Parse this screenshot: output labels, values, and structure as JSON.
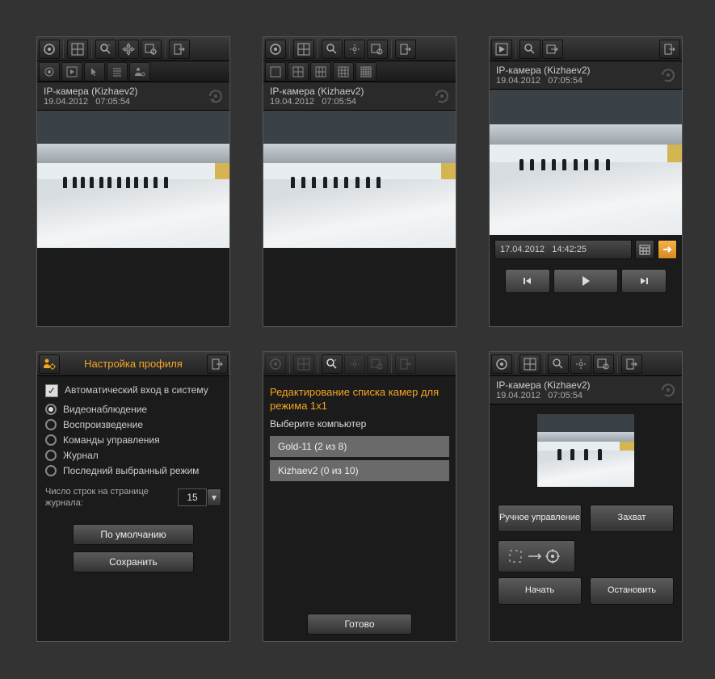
{
  "camera": {
    "name": "IP-камера (Kizhaev2)",
    "date": "19.04.2012",
    "time": "07:05:54"
  },
  "panel3": {
    "date": "17.04.2012",
    "time": "14:42:25"
  },
  "profile": {
    "title": "Настройка профиля",
    "autologin": "Автоматический вход в систему",
    "mode1": "Видеонаблюдение",
    "mode2": "Воспроизведение",
    "mode3": "Команды управления",
    "mode4": "Журнал",
    "mode5": "Последний выбранный режим",
    "lines_label": "Число строк на странице журнала:",
    "lines_value": "15",
    "btn_default": "По умолчанию",
    "btn_save": "Сохранить"
  },
  "editlist": {
    "title": "Редактирование списка камер для режима 1x1",
    "subtitle": "Выберите компьютер",
    "item1": "Gold-11 (2 из 8)",
    "item2": "Kizhaev2 (0 из 10)",
    "btn_done": "Готово"
  },
  "control": {
    "btn_manual": "Ручное управление",
    "btn_capture": "Захват",
    "btn_start": "Начать",
    "btn_stop": "Остановить"
  }
}
